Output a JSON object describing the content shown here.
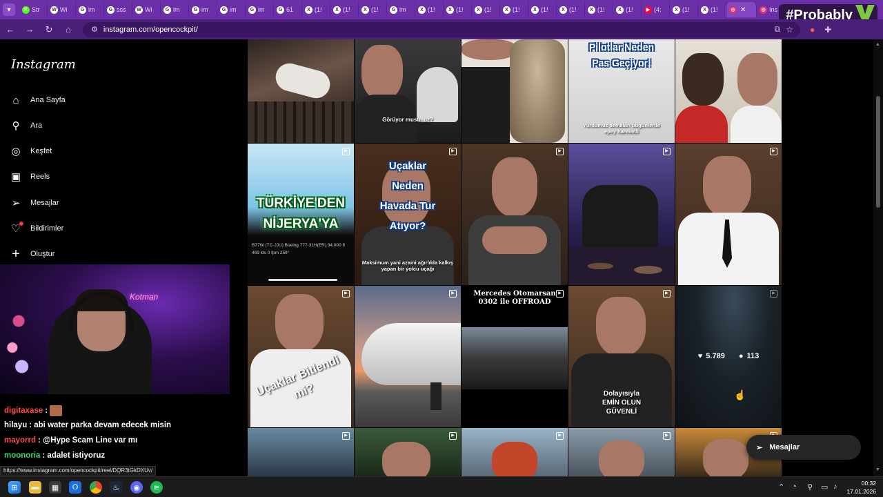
{
  "browser": {
    "tabs": [
      {
        "label": "Str",
        "icon": "K",
        "color": "#53fc18"
      },
      {
        "label": "Wi",
        "icon": "W",
        "color": "#ffffff"
      },
      {
        "label": "im",
        "icon": "G",
        "color": "#ffffff"
      },
      {
        "label": "sss",
        "icon": "G",
        "color": "#ffffff"
      },
      {
        "label": "Wi",
        "icon": "W",
        "color": "#ffffff"
      },
      {
        "label": "im",
        "icon": "G",
        "color": "#ffffff"
      },
      {
        "label": "im",
        "icon": "G",
        "color": "#ffffff"
      },
      {
        "label": "im",
        "icon": "G",
        "color": "#ffffff"
      },
      {
        "label": "im",
        "icon": "G",
        "color": "#ffffff"
      },
      {
        "label": "61",
        "icon": "G",
        "color": "#ffffff"
      },
      {
        "label": "(1!",
        "icon": "X",
        "color": "#ffffff"
      },
      {
        "label": "(1!",
        "icon": "X",
        "color": "#ffffff"
      },
      {
        "label": "(1!",
        "icon": "X",
        "color": "#ffffff"
      },
      {
        "label": "im",
        "icon": "G",
        "color": "#ffffff"
      },
      {
        "label": "(1!",
        "icon": "X",
        "color": "#ffffff"
      },
      {
        "label": "(1!",
        "icon": "X",
        "color": "#ffffff"
      },
      {
        "label": "(1!",
        "icon": "X",
        "color": "#ffffff"
      },
      {
        "label": "(1!",
        "icon": "X",
        "color": "#ffffff"
      },
      {
        "label": "(1!",
        "icon": "X",
        "color": "#ffffff"
      },
      {
        "label": "(1!",
        "icon": "X",
        "color": "#ffffff"
      },
      {
        "label": "(1!",
        "icon": "X",
        "color": "#ffffff"
      },
      {
        "label": "(1!",
        "icon": "X",
        "color": "#ffffff"
      },
      {
        "label": "(4:",
        "icon": "▶",
        "color": "#ff0033"
      },
      {
        "label": "(1!",
        "icon": "X",
        "color": "#ffffff"
      },
      {
        "label": "(1!",
        "icon": "X",
        "color": "#ffffff"
      }
    ],
    "active_tab_close": "✕",
    "last_tab_label": "Ins",
    "brand_text": "#Probably",
    "url": "instagram.com/opencockpit/",
    "status_url": "https://www.instagram.com/opencockpit/reel/DQR3tGkDXUv/"
  },
  "sidebar": {
    "logo": "Instagram",
    "items": [
      {
        "label": "Ana Sayfa",
        "icon": "home-icon",
        "glyph": "⌂"
      },
      {
        "label": "Ara",
        "icon": "search-icon",
        "glyph": "⚲"
      },
      {
        "label": "Keşfet",
        "icon": "compass-icon",
        "glyph": "◎"
      },
      {
        "label": "Reels",
        "icon": "reels-icon",
        "glyph": "▣"
      },
      {
        "label": "Mesajlar",
        "icon": "send-icon",
        "glyph": "➢"
      },
      {
        "label": "Bildirimler",
        "icon": "heart-icon",
        "glyph": "♡"
      },
      {
        "label": "Oluştur",
        "icon": "plus-icon",
        "glyph": "+"
      }
    ]
  },
  "webcam": {
    "neon_sign": "Kotman"
  },
  "chat": {
    "lines": [
      {
        "user": "digitaxase",
        "user_color": "#ff4b4b",
        "message": ""
      },
      {
        "user": "hilayu",
        "user_color": "#ffffff",
        "message": "abi water parka devam edecek misin"
      },
      {
        "user": "mayorrd",
        "user_color": "#ff4b4b",
        "message": "@Hype Scam Line var mı"
      },
      {
        "user": "moonoria",
        "user_color": "#3cd46e",
        "message": "adalet istiyoruz"
      }
    ]
  },
  "grid": {
    "captions": {
      "t2": "Görüyor musunuz?",
      "t4_title": "Pilotlar Neden Pas Geçiyor!",
      "t4_sub": "Yurdumuz semaları bugünlerde epey hareketli",
      "t6": "TÜRKİYE'DEN NİJERYA'YA",
      "t6_panel": "B77W (TC-JJU)  Boeing 777-31H(ER)  34,000 ft  469 kts  0 fpm  259°",
      "t7_title": "Uçaklar Neden Havada Tur Atıyor?",
      "t7_sub": "Maksimum yani azami ağırlıkla kalkış yapan bir yolcu uçağı",
      "t11": "Uçaklar Bitlendi mi?",
      "t13": "Mercedes Otomarsan 0302 ile OFFROAD",
      "t14": "Dolayısıyla EMİN OLUN GÜVENLİ"
    },
    "hover": {
      "likes": "5.789",
      "comments": "113"
    }
  },
  "messages_button": {
    "label": "Mesajlar"
  },
  "taskbar": {
    "time": "00:32",
    "date": "17.01.2026"
  }
}
